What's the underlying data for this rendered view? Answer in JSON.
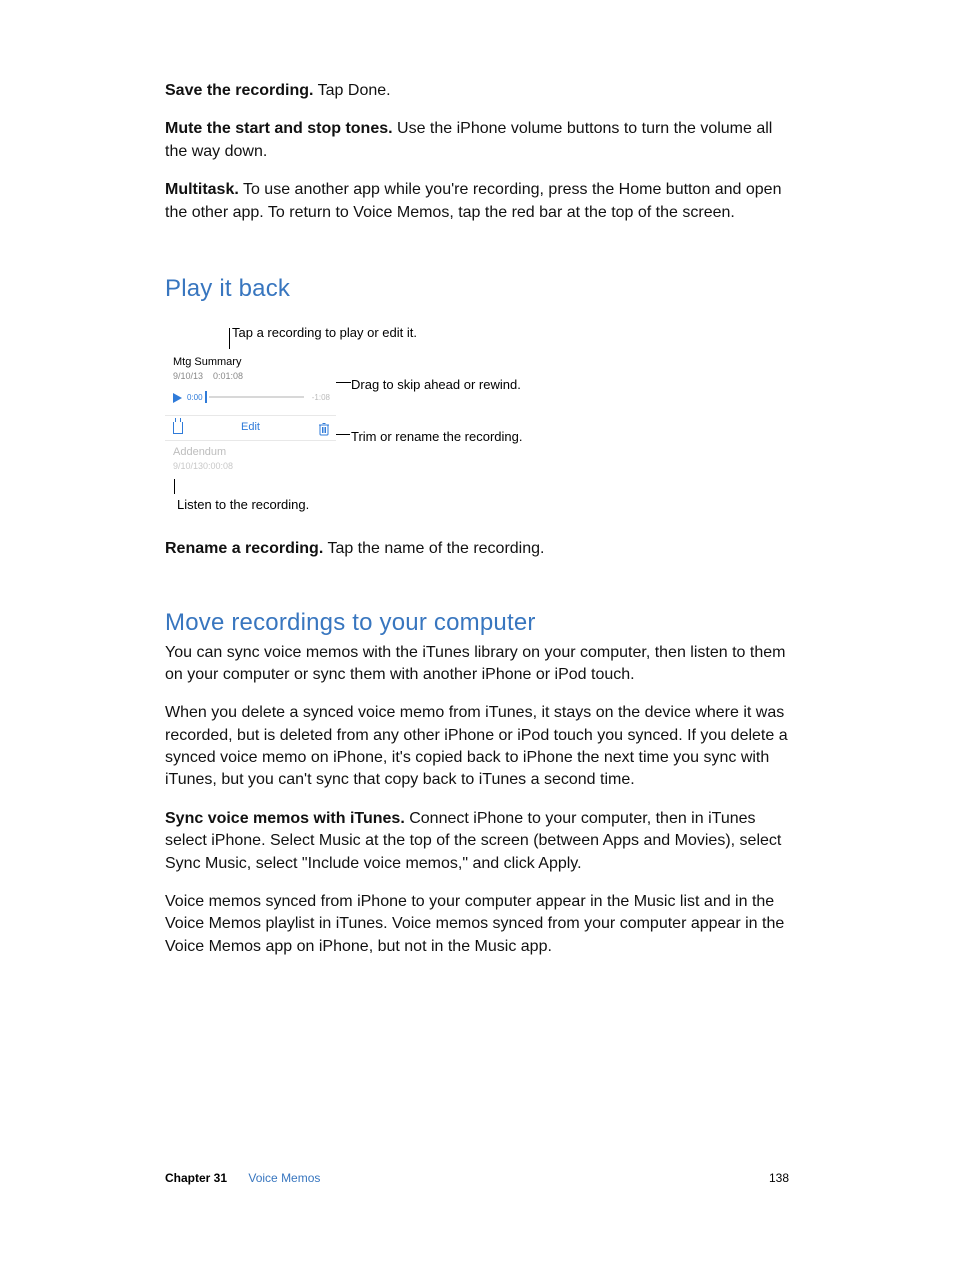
{
  "paragraphs": {
    "p1_bold": "Save the recording.",
    "p1_rest": " Tap Done.",
    "p2_bold": "Mute the start and stop tones.",
    "p2_rest": " Use the iPhone volume buttons to turn the volume all the way down.",
    "p3_bold": "Multitask.",
    "p3_rest": " To use another app while you're recording, press the Home button and open the other app. To return to Voice Memos, tap the red bar at the top of the screen.",
    "p4_bold": "Rename a recording.",
    "p4_rest": " Tap the name of the recording.",
    "p5": "You can sync voice memos with the iTunes library on your computer, then listen to them on your computer or sync them with another iPhone or iPod touch.",
    "p6": "When you delete a synced voice memo from iTunes, it stays on the device where it was recorded, but is deleted from any other iPhone or iPod touch you synced. If you delete a synced voice memo on iPhone, it's copied back to iPhone the next time you sync with iTunes, but you can't sync that copy back to iTunes a second time.",
    "p7_bold": "Sync voice memos with iTunes.",
    "p7_rest": " Connect iPhone to your computer, then in iTunes select iPhone. Select Music at the top of the screen (between Apps and Movies), select Sync Music, select \"Include voice memos,\" and click Apply.",
    "p8": "Voice memos synced from iPhone to your computer appear in the Music list and in the Voice Memos playlist in iTunes. Voice memos synced from your computer appear in the Voice Memos app on iPhone, but not in the Music app."
  },
  "headings": {
    "h1": "Play it back",
    "h2": "Move recordings to your computer"
  },
  "figure": {
    "callout_top": "Tap a recording to play or edit it.",
    "callout_right1": "Drag to skip ahead or rewind.",
    "callout_right2": "Trim or rename the recording.",
    "callout_bottom": "Listen to the recording.",
    "memo1_title": "Mtg Summary",
    "memo1_date": "9/10/13",
    "memo1_dur": "0:01:08",
    "time_left": "0:00",
    "time_right": "-1:08",
    "edit_label": "Edit",
    "memo2_title": "Addendum",
    "memo2_date": "9/10/13",
    "memo2_dur": "0:00:08"
  },
  "footer": {
    "chapter_label": "Chapter  31",
    "chapter_title": "Voice Memos",
    "page_number": "138"
  }
}
